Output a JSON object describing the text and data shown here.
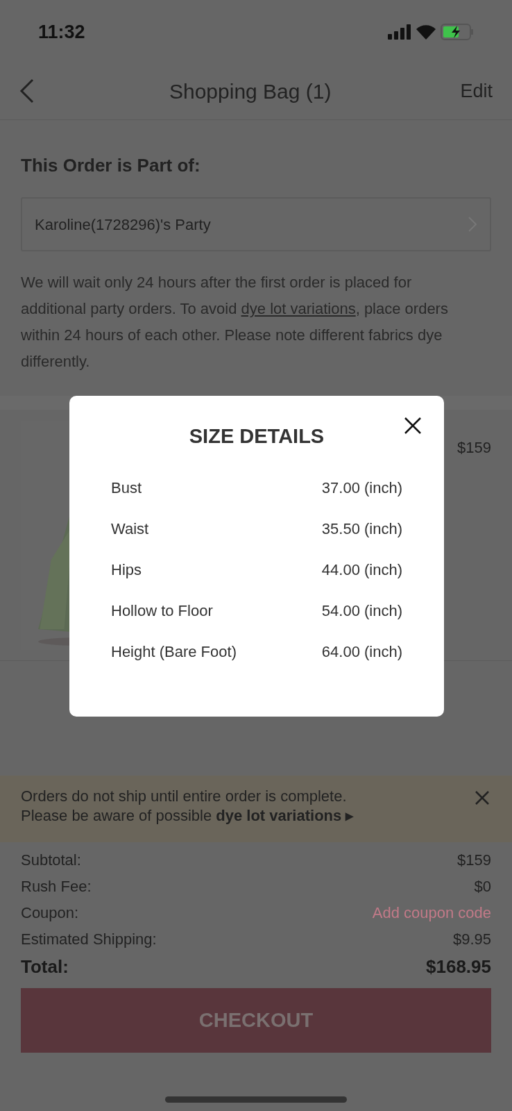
{
  "status_bar": {
    "time": "11:32"
  },
  "nav": {
    "title": "Shopping Bag (1)",
    "action": "Edit"
  },
  "party": {
    "heading": "This Order is Part of:",
    "selector": "Karoline(1728296)'s Party",
    "notice_before": "We will wait only 24 hours after the first order is placed for additional party orders. To avoid ",
    "notice_link": "dye lot variations",
    "notice_after": ", place orders within 24 hours of each other. Please note different fabrics dye differently."
  },
  "product": {
    "price": "$159"
  },
  "banner": {
    "line_1": "Orders do not ship until entire order is complete.",
    "line_2": "Please be aware of possible ",
    "link": "dye lot variations ▸"
  },
  "summary": [
    {
      "label": "Subtotal:",
      "value": "$159",
      "kind": "amount"
    },
    {
      "label": "Rush Fee:",
      "value": "$0",
      "kind": "amount"
    },
    {
      "label": "Coupon:",
      "value": "Add coupon code",
      "kind": "link"
    },
    {
      "label": "Estimated Shipping:",
      "value": "$9.95",
      "kind": "amount"
    }
  ],
  "total": {
    "label": "Total:",
    "value": "$168.95"
  },
  "checkout": {
    "label": "CHECKOUT"
  },
  "modal": {
    "title": "SIZE DETAILS",
    "rows": [
      {
        "label": "Bust",
        "value": "37.00 (inch)"
      },
      {
        "label": "Waist",
        "value": "35.50 (inch)"
      },
      {
        "label": "Hips",
        "value": "44.00 (inch)"
      },
      {
        "label": "Hollow to Floor",
        "value": "54.00 (inch)"
      },
      {
        "label": "Height (Bare Foot)",
        "value": "64.00 (inch)"
      }
    ]
  }
}
